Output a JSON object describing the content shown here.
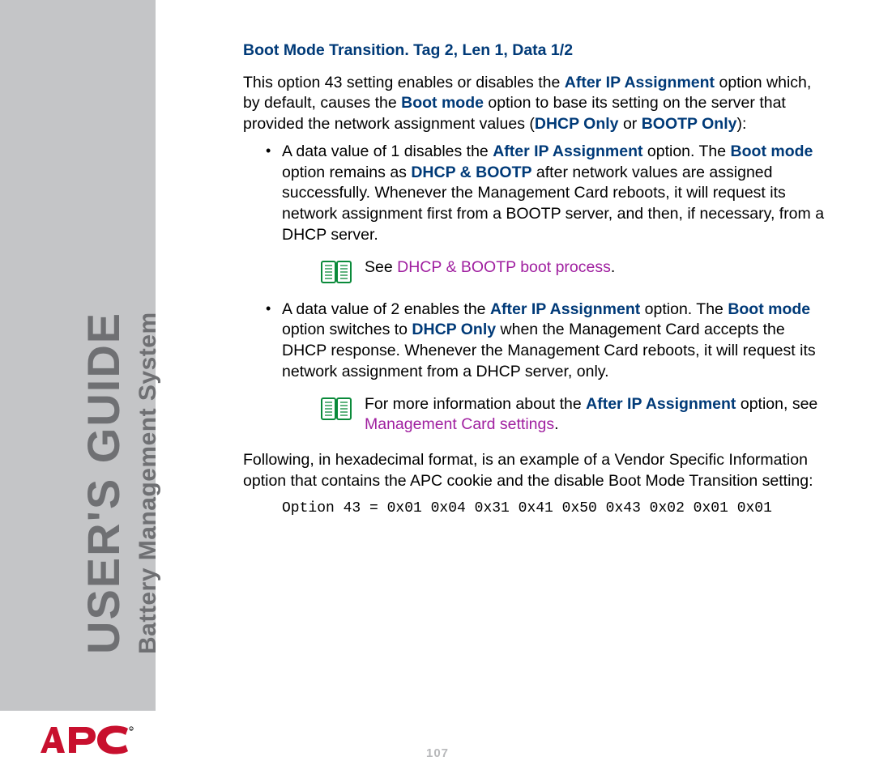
{
  "sidebar": {
    "title_main": "USER'S GUIDE",
    "title_sub": "Battery Management System"
  },
  "logo": {
    "brand": "APC"
  },
  "page_number": "107",
  "content": {
    "heading": "Boot Mode Transition. Tag 2, Len 1, Data 1/2",
    "intro": {
      "t1": "This option 43 setting enables or disables the ",
      "b1": "After IP Assignment",
      "t2": " option which, by default, causes the ",
      "b2": "Boot mode",
      "t3": " option to base its setting on the server that provided the network assignment values (",
      "b3": "DHCP Only",
      "t4": " or ",
      "b4": "BOOTP Only",
      "t5": "):"
    },
    "bullets": [
      {
        "t1": "A data value of 1 disables the ",
        "b1": "After IP Assignment",
        "t2": " option. The ",
        "b2": "Boot mode",
        "t3": " option remains as ",
        "b3": "DHCP & BOOTP",
        "t4": " after network values are assigned successfully. Whenever the Management Card reboots, it will request its network assignment first from a BOOTP server, and then, if necessary, from a DHCP server.",
        "note": {
          "pre": "See ",
          "link": "DHCP & BOOTP boot process",
          "post": "."
        }
      },
      {
        "t1": "A data value of 2 enables the ",
        "b1": "After IP Assignment",
        "t2": " option. The ",
        "b2": "Boot mode",
        "t3": " option switches to ",
        "b3": "DHCP Only",
        "t4": " when the Management Card accepts the DHCP response. Whenever the Management Card reboots, it will request its network assignment from a DHCP server, only.",
        "note": {
          "pre": "For more information about the ",
          "bold": "After IP Assignment",
          "mid": " option, see ",
          "link": "Management Card settings",
          "post": "."
        }
      }
    ],
    "closing": "Following, in hexadecimal format, is an example of a Vendor Specific Information option that contains the APC cookie and the disable Boot Mode Transition setting:",
    "code": "Option 43 = 0x01 0x04 0x31 0x41 0x50 0x43 0x02 0x01 0x01"
  }
}
